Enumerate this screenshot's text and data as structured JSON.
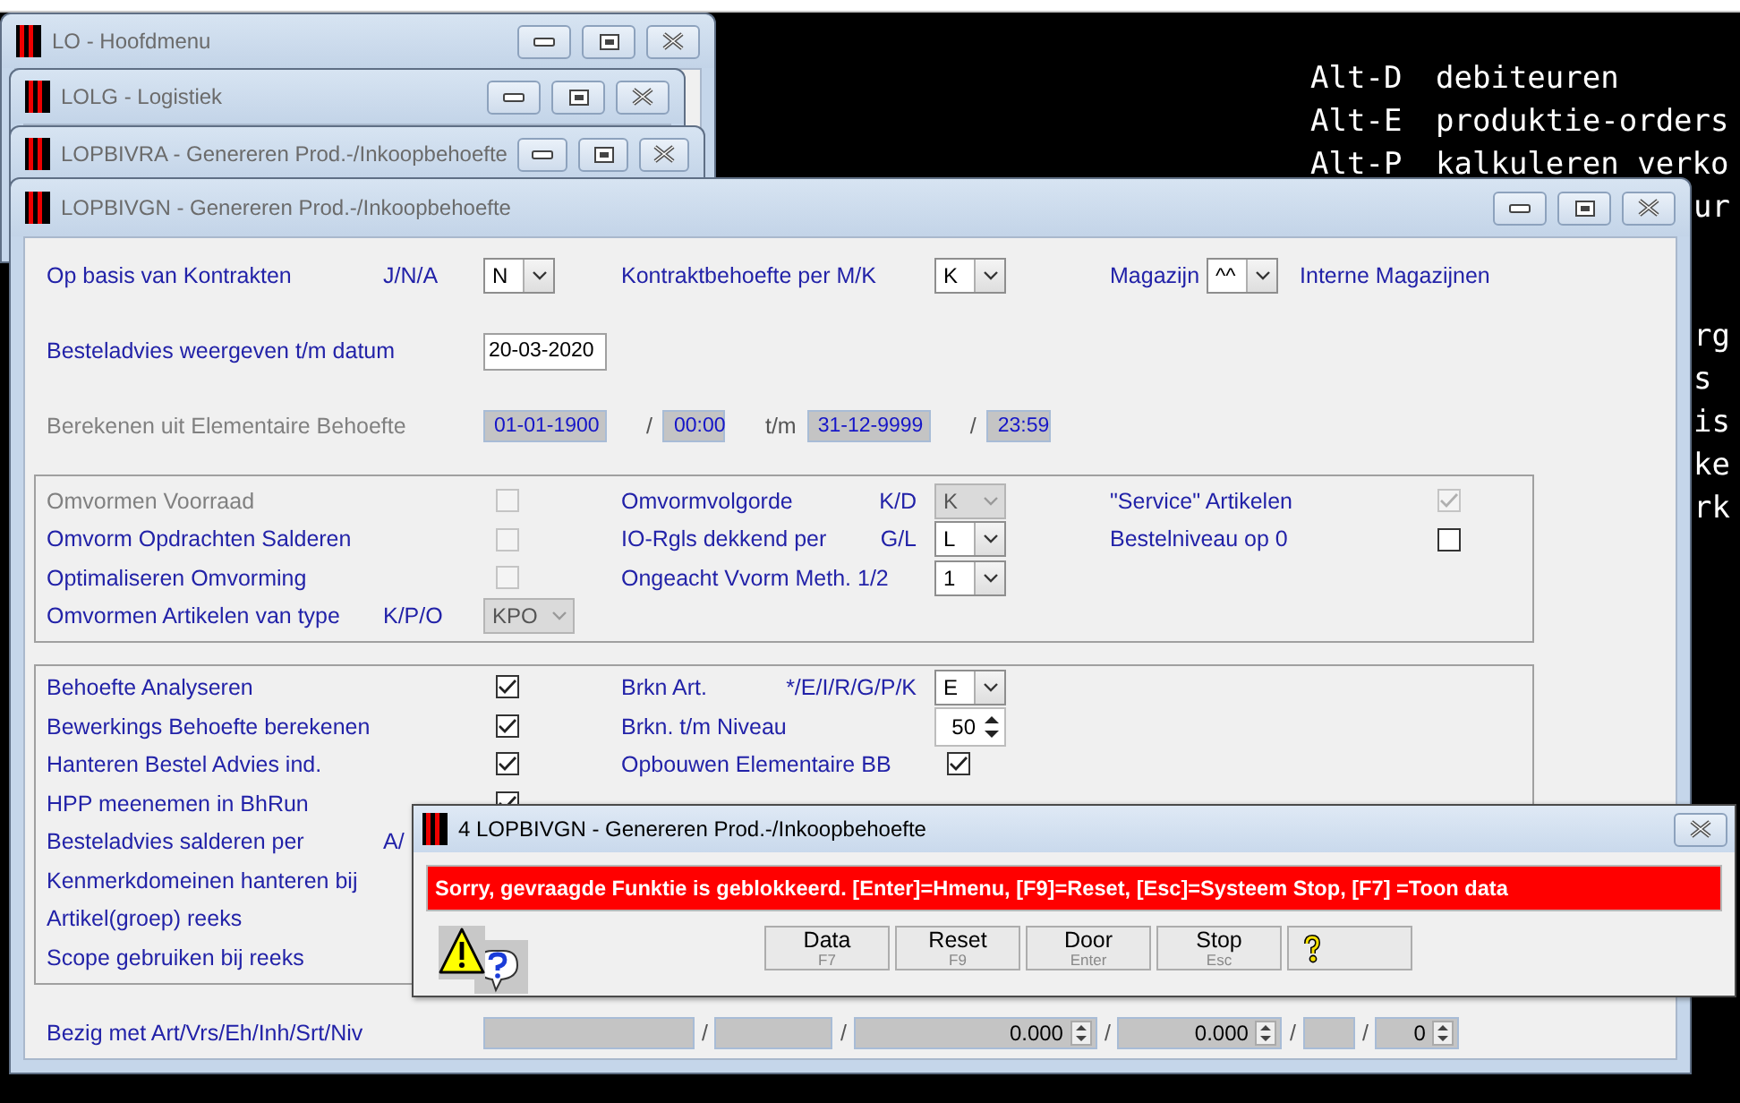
{
  "desktop_windows": [
    {
      "title": "LO - Hoofdmenu"
    },
    {
      "title": "LOLG - Logistiek"
    },
    {
      "title": "LOPBIVRA - Genereren Prod.-/Inkoopbehoefte"
    }
  ],
  "terminal": {
    "menu_lines": [
      {
        "key": "Alt-D",
        "text": "debiteuren"
      },
      {
        "key": "Alt-E",
        "text": "produktie-orders"
      },
      {
        "key": "Alt-P",
        "text": "kalkuleren verko"
      }
    ],
    "upper_fragments": [
      "ur"
    ],
    "lower_fragments": [
      "rg",
      "s",
      "is",
      "ke",
      "rk"
    ]
  },
  "main_window": {
    "title": "LOPBIVGN - Genereren Prod.-/Inkoopbehoefte",
    "header_rows": [
      {
        "kind": "grid",
        "left": {
          "label": "Op basis van Kontrakten",
          "disabled": false,
          "code": "J/N/A",
          "control": {
            "kind": "select",
            "value": "N",
            "disabled": false
          }
        },
        "middle": {
          "label": "Kontraktbehoefte per M/K",
          "disabled": false,
          "control": {
            "kind": "select",
            "value": "K",
            "disabled": false
          }
        },
        "right": {
          "label": "Magazijn",
          "disabled": false,
          "control": {
            "kind": "select",
            "value": "^^",
            "disabled": false
          },
          "note": "Interne Magazijnen"
        }
      },
      {
        "kind": "grid",
        "left": {
          "label": "Besteladvies weergeven t/m datum",
          "disabled": false,
          "control": {
            "kind": "date",
            "value": "20-03-2020"
          }
        }
      },
      {
        "kind": "period",
        "label": "Berekenen uit Elementaire Behoefte",
        "disabled": true,
        "parts": [
          {
            "kind": "readonly",
            "value": "01-01-1900"
          },
          {
            "kind": "text",
            "text": "/"
          },
          {
            "kind": "readonly",
            "value": "00:00"
          },
          {
            "kind": "text",
            "text": "t/m"
          },
          {
            "kind": "readonly",
            "value": "31-12-9999"
          },
          {
            "kind": "text",
            "text": "/"
          },
          {
            "kind": "readonly",
            "value": "23:59"
          }
        ]
      }
    ],
    "groups": [
      {
        "rows": [
          {
            "kind": "grid",
            "left": {
              "label": "Omvormen Voorraad",
              "disabled": true,
              "control": {
                "kind": "checkbox",
                "checked": false,
                "disabled": true
              }
            },
            "middle": {
              "label": "Omvormvolgorde",
              "disabled": false,
              "code": "K/D",
              "control": {
                "kind": "select",
                "value": "K",
                "disabled": true
              }
            },
            "right": {
              "label": "\"Service\" Artikelen",
              "disabled": false,
              "control": {
                "kind": "checkbox",
                "checked": true,
                "disabled": true
              }
            }
          },
          {
            "kind": "grid",
            "left": {
              "label": "Omvorm Opdrachten Salderen",
              "disabled": false,
              "control": {
                "kind": "checkbox",
                "checked": false,
                "disabled": true
              }
            },
            "middle": {
              "label": "IO-Rgls dekkend per",
              "disabled": false,
              "code": "G/L",
              "control": {
                "kind": "select",
                "value": "L",
                "disabled": false
              }
            },
            "right": {
              "label": "Bestelniveau op 0",
              "disabled": false,
              "control": {
                "kind": "checkbox",
                "checked": false,
                "disabled": false
              }
            }
          },
          {
            "kind": "grid",
            "left": {
              "label": "Optimaliseren Omvorming",
              "disabled": false,
              "control": {
                "kind": "checkbox",
                "checked": false,
                "disabled": true
              }
            },
            "middle": {
              "label": "Ongeacht Vvorm Meth. 1/2",
              "disabled": false,
              "control": {
                "kind": "select",
                "value": "1",
                "disabled": false
              }
            }
          },
          {
            "kind": "grid",
            "left": {
              "label": "Omvormen Artikelen van type",
              "disabled": false,
              "code": "K/P/O",
              "control": {
                "kind": "select",
                "value": "KPO",
                "disabled": true
              }
            }
          }
        ]
      },
      {
        "rows": [
          {
            "kind": "grid",
            "left": {
              "label": "Behoefte Analyseren",
              "disabled": false,
              "control": {
                "kind": "checkbox",
                "checked": true,
                "disabled": false
              }
            },
            "middle": {
              "label": "Brkn Art.",
              "disabled": false,
              "code": "*/E/I/R/G/P/K",
              "control": {
                "kind": "select",
                "value": "E",
                "disabled": false
              }
            }
          },
          {
            "kind": "grid",
            "left": {
              "label": "Bewerkings Behoefte berekenen",
              "disabled": false,
              "control": {
                "kind": "checkbox",
                "checked": true,
                "disabled": false
              }
            },
            "middle": {
              "label": "Brkn. t/m Niveau",
              "disabled": false,
              "control": {
                "kind": "spinner",
                "value": "50"
              }
            }
          },
          {
            "kind": "grid",
            "left": {
              "label": "Hanteren Bestel Advies ind.",
              "disabled": false,
              "control": {
                "kind": "checkbox",
                "checked": true,
                "disabled": false
              }
            },
            "middle": {
              "label": "Opbouwen Elementaire BB",
              "disabled": false,
              "control": {
                "kind": "checkbox",
                "checked": true,
                "disabled": false
              }
            }
          },
          {
            "kind": "grid",
            "left": {
              "label": "HPP meenemen in BhRun",
              "disabled": false,
              "control": {
                "kind": "checkbox",
                "checked": true,
                "disabled": false
              }
            }
          },
          {
            "kind": "grid",
            "left": {
              "label": "Besteladvies salderen per",
              "disabled": false,
              "code": "A/"
            }
          },
          {
            "kind": "grid",
            "left": {
              "label": "Kenmerkdomeinen hanteren bij",
              "disabled": false
            }
          },
          {
            "kind": "grid",
            "left": {
              "label": "Artikel(groep) reeks",
              "disabled": false
            }
          },
          {
            "kind": "grid",
            "left": {
              "label": "Scope gebruiken bij reeks",
              "disabled": false
            }
          }
        ]
      }
    ],
    "progress_row": {
      "kind": "progress",
      "label": "Bezig met Art/Vrs/Eh/Inh/Srt/Niv",
      "disabled": false,
      "parts": [
        {
          "kind": "readonly"
        },
        {
          "kind": "text",
          "text": "/"
        },
        {
          "kind": "readonly"
        },
        {
          "kind": "text",
          "text": "/"
        },
        {
          "kind": "readonly_spinner",
          "value": "0.000"
        },
        {
          "kind": "text",
          "text": "/"
        },
        {
          "kind": "readonly_spinner",
          "value": "0.000"
        },
        {
          "kind": "text",
          "text": "/"
        },
        {
          "kind": "readonly"
        },
        {
          "kind": "text",
          "text": "/"
        },
        {
          "kind": "readonly_spinner",
          "value": "0"
        }
      ]
    }
  },
  "dialog": {
    "title": "4 LOPBIVGN - Genereren Prod.-/Inkoopbehoefte",
    "message": "Sorry, gevraagde Funktie is geblokkeerd.  [Enter]=Hmenu, [F9]=Reset, [Esc]=Systeem Stop, [F7] =Toon data",
    "buttons": [
      {
        "kind": "text",
        "label": "Data",
        "shortcut": "F7"
      },
      {
        "kind": "text",
        "label": "Reset",
        "shortcut": "F9"
      },
      {
        "kind": "text",
        "label": "Door",
        "shortcut": "Enter"
      },
      {
        "kind": "text",
        "label": "Stop",
        "shortcut": "Esc"
      },
      {
        "kind": "help"
      }
    ]
  }
}
